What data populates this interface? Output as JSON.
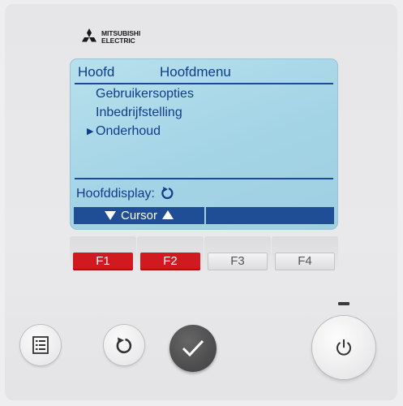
{
  "brand": {
    "line1": "MITSUBISHI",
    "line2": "ELECTRIC"
  },
  "screen": {
    "left_title": "Hoofd",
    "right_title": "Hoofdmenu",
    "menu_items": [
      "Gebruikersopties",
      "Inbedrijfstelling",
      "Onderhoud"
    ],
    "selected_index": 2,
    "footer_label": "Hoofddisplay:",
    "function_bar": {
      "segment1_label": "Cursor",
      "segment2_label": ""
    }
  },
  "fkeys": [
    {
      "label": "F1",
      "state": "active"
    },
    {
      "label": "F2",
      "state": "active"
    },
    {
      "label": "F3",
      "state": "inactive"
    },
    {
      "label": "F4",
      "state": "inactive"
    }
  ],
  "buttons": {
    "menu": "menu-icon",
    "return": "return-icon",
    "select": "checkmark-icon",
    "power": "power-icon"
  },
  "colors": {
    "lcd_bg": "#a3d4e6",
    "lcd_text": "#103c8c",
    "fkey_active": "#d11a1f",
    "select_button": "#3f3f41"
  }
}
